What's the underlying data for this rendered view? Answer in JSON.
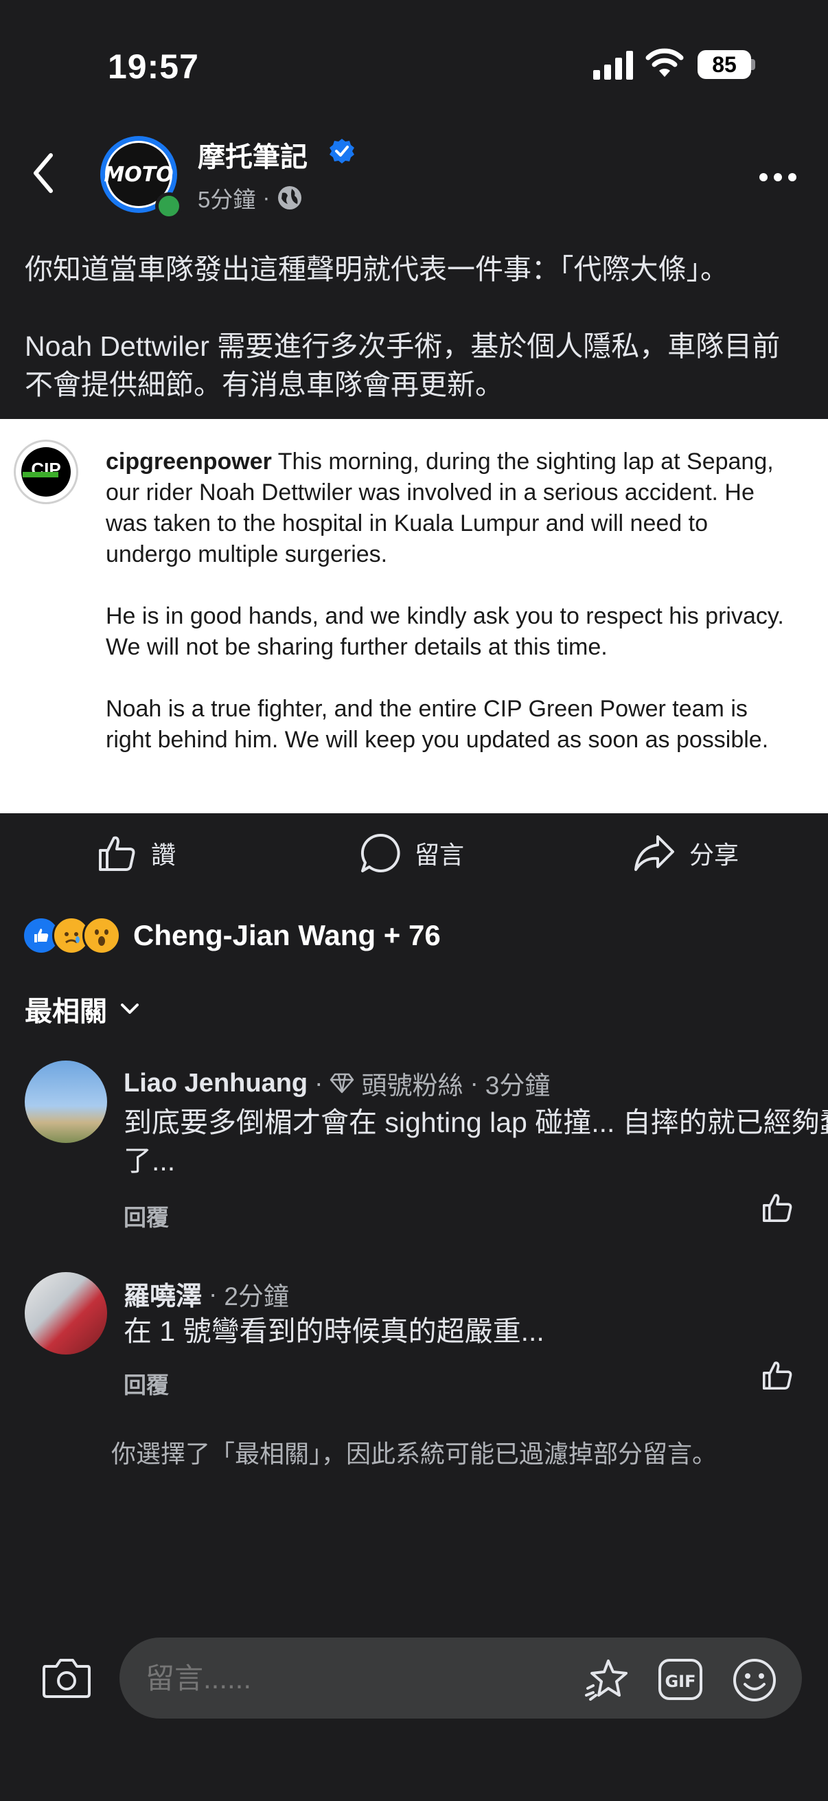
{
  "status_bar": {
    "time": "19:57",
    "battery": "85"
  },
  "post": {
    "page_name": "摩托筆記",
    "page_logo_text": "MOTO",
    "time": "5分鐘",
    "separator": "·",
    "paragraphs": [
      "你知道當車隊發出這種聲明就代表一件事：「代際大條」。",
      "Noah Dettwiler 需要進行多次手術，基於個人隱私，車隊目前不會提供細節。有消息車隊會再更新。"
    ]
  },
  "embed": {
    "logo_text": "CIP",
    "account": "cipgreenpower",
    "paragraphs": [
      "This morning, during the sighting lap at Sepang, our rider Noah Dettwiler was involved in a serious accident. He was taken to the hospital in Kuala Lumpur and will need to undergo multiple surgeries.",
      "He is in good hands, and we kindly ask you to respect his privacy. We will not be sharing further details at this time.",
      "Noah is a true fighter, and the entire CIP Green Power team is right behind him. We will keep you updated as soon as possible."
    ]
  },
  "actions": {
    "like": "讚",
    "comment": "留言",
    "share": "分享"
  },
  "reactions": {
    "summary": "Cheng-Jian Wang + 76"
  },
  "sort": {
    "label": "最相關"
  },
  "comments": [
    {
      "name": "Liao Jenhuang",
      "badge": "頭號粉絲",
      "time": "3分鐘",
      "text": "到底要多倒楣才會在 sighting lap 碰撞... 自摔的就已經夠蠢了...",
      "reply": "回覆"
    },
    {
      "name": "羅嘵澤",
      "time": "2分鐘",
      "text": "在 1 號彎看到的時候真的超嚴重...",
      "reply": "回覆"
    }
  ],
  "filter_note": "你選擇了「最相關」，因此系統可能已過濾掉部分留言。",
  "composer": {
    "placeholder": "留言......"
  },
  "colors": {
    "background": "#1c1c1e",
    "accent": "#1877f2",
    "online": "#31a24c",
    "muted": "#b0b3b8"
  },
  "icons": [
    "back-icon",
    "verified-icon",
    "globe-icon",
    "more-icon",
    "like-icon",
    "comment-icon",
    "share-icon",
    "chevron-down-icon",
    "diamond-icon",
    "camera-icon",
    "sticker-icon",
    "gif-icon",
    "emoji-icon"
  ]
}
